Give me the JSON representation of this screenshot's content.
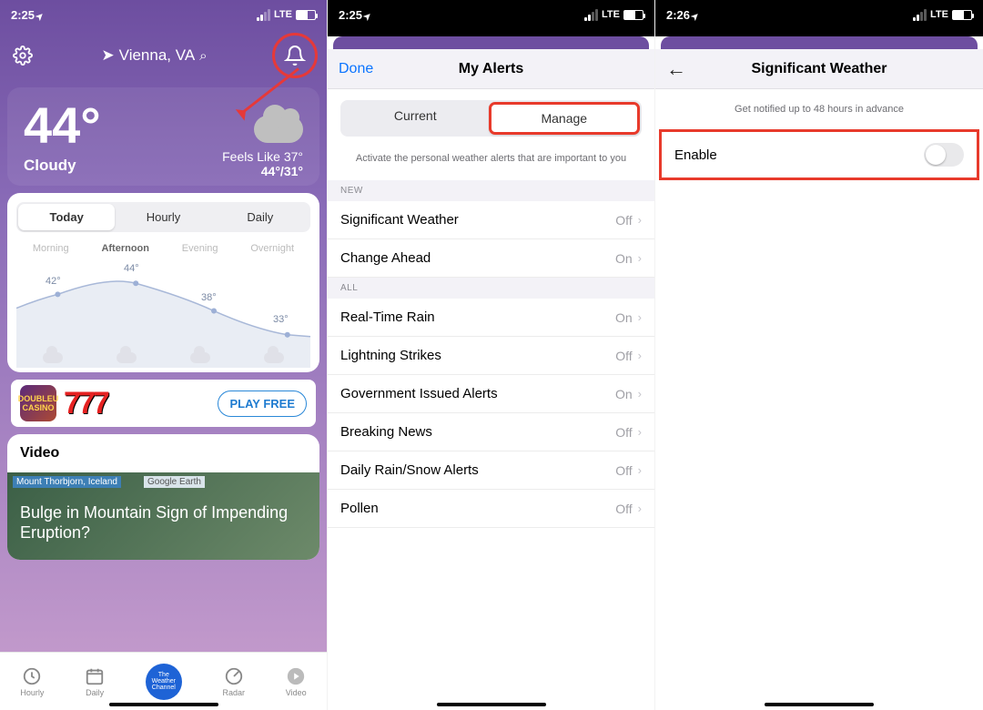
{
  "s1": {
    "status_time": "2:25",
    "carrier": "LTE",
    "location": "Vienna, VA",
    "temp": "44°",
    "condition": "Cloudy",
    "feels_like": "Feels Like 37°",
    "hilo": "44°/31°",
    "tabs": [
      "Today",
      "Hourly",
      "Daily"
    ],
    "parts": [
      "Morning",
      "Afternoon",
      "Evening",
      "Overnight"
    ],
    "ad_label": "PLAY FREE",
    "ad_logo_text": "DOUBLEU CASINO",
    "sevens": "777",
    "video_section": "Video",
    "video_tag1": "Mount Thorbjorn, Iceland",
    "video_tag2": "Google Earth",
    "video_headline": "Bulge in Mountain Sign of Impending Eruption?",
    "nav": [
      "Hourly",
      "Daily",
      "Radar",
      "Video"
    ],
    "nav_center_text": "The Weather Channel"
  },
  "chart_data": {
    "type": "line",
    "categories": [
      "Morning",
      "Afternoon",
      "Evening",
      "Overnight"
    ],
    "values": [
      42,
      44,
      38,
      33
    ],
    "value_labels": [
      "42°",
      "44°",
      "38°",
      "33°"
    ],
    "ylim": [
      30,
      46
    ]
  },
  "s2": {
    "status_time": "2:25",
    "done": "Done",
    "title": "My Alerts",
    "seg": [
      "Current",
      "Manage"
    ],
    "helper": "Activate the personal weather alerts that are important to you",
    "sec_new": "NEW",
    "sec_all": "ALL",
    "rows_new": [
      {
        "label": "Significant Weather",
        "value": "Off"
      },
      {
        "label": "Change Ahead",
        "value": "On"
      }
    ],
    "rows_all": [
      {
        "label": "Real-Time Rain",
        "value": "On"
      },
      {
        "label": "Lightning Strikes",
        "value": "Off"
      },
      {
        "label": "Government Issued Alerts",
        "value": "On"
      },
      {
        "label": "Breaking News",
        "value": "Off"
      },
      {
        "label": "Daily Rain/Snow Alerts",
        "value": "Off"
      },
      {
        "label": "Pollen",
        "value": "Off"
      }
    ]
  },
  "s3": {
    "status_time": "2:26",
    "title": "Significant Weather",
    "subtitle": "Get notified up to 48 hours in advance",
    "enable": "Enable"
  }
}
